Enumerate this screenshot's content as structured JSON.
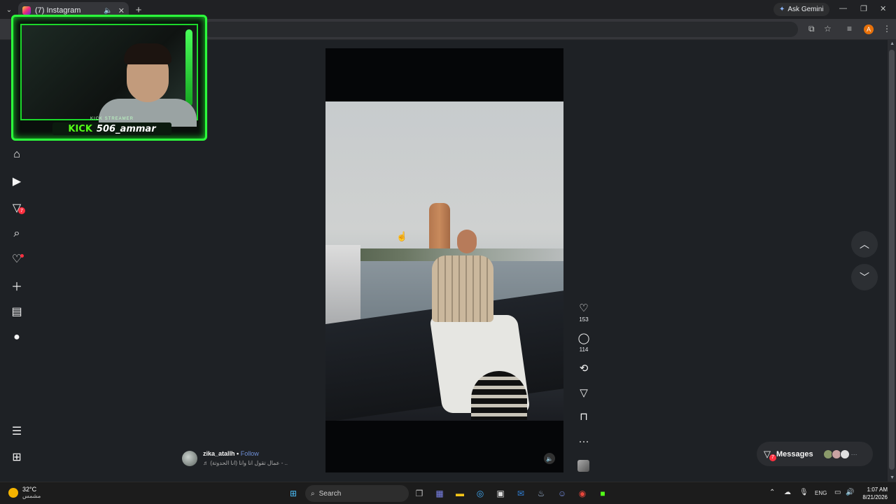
{
  "browser": {
    "tab_title": "(7) Instagram",
    "new_tab": "+",
    "ask_gemini": "Ask Gemini",
    "window_minimize": "—",
    "window_restore": "❐",
    "window_close": "✕"
  },
  "stream_overlay": {
    "platform": "KICK",
    "tag": "KICK STREAMER",
    "channel": "506_ammar"
  },
  "sidebar": {
    "items": [
      "home-icon",
      "reels-icon",
      "direct-icon",
      "search-icon",
      "notifications-icon",
      "create-icon",
      "insights-icon",
      "profile-icon",
      "menu-icon",
      "more-apps-icon"
    ],
    "direct_badge": "7"
  },
  "post": {
    "username": "zika_atallh",
    "separator": "•",
    "follow": "Follow",
    "audio": "♬ عمال تقول انا وانا (انا الحدوتة) - ..",
    "likes": "153",
    "comments": "114"
  },
  "messages": {
    "label": "Messages",
    "badge": "7",
    "more": "···"
  },
  "taskbar": {
    "temp": "32°C",
    "condition": "مشمس",
    "search_placeholder": "Search",
    "language": "ENG",
    "time": "1:07 AM",
    "date": "8/21/2026"
  },
  "colors": {
    "accent_green": "#53fc18",
    "notification_red": "#ff3040",
    "follow_blue": "#6f8fd6"
  }
}
